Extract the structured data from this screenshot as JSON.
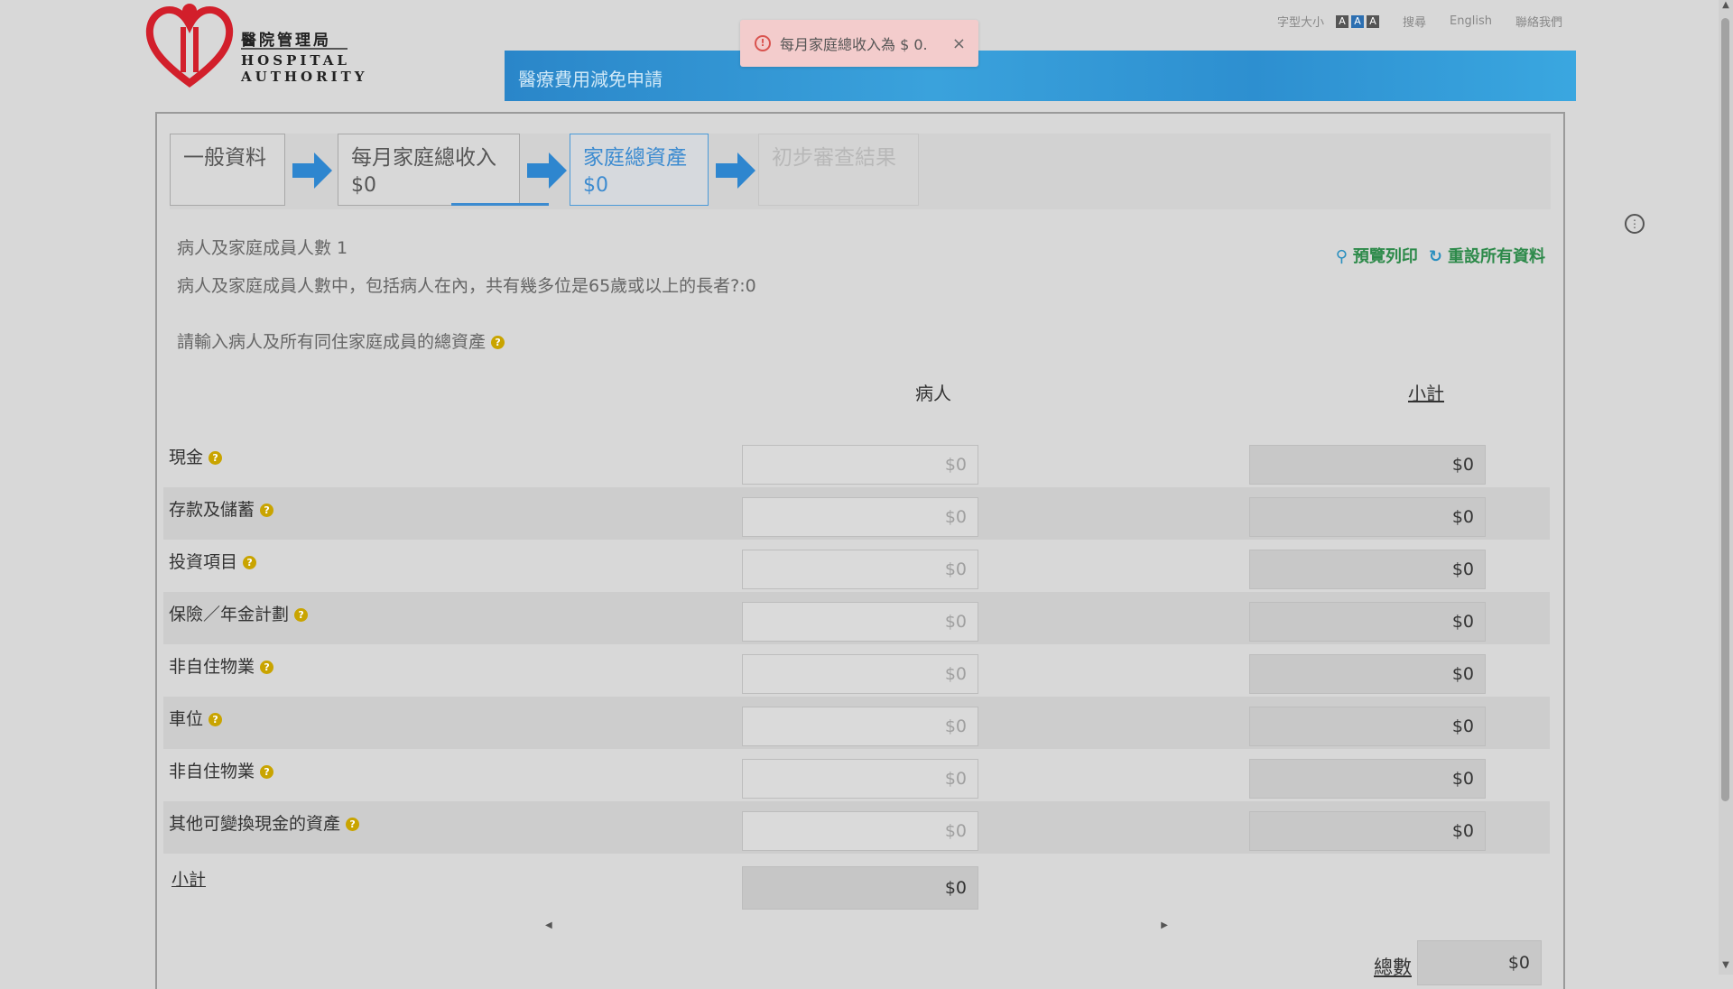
{
  "header": {
    "logo_zh": "醫院管理局",
    "logo_en_1": "HOSPITAL",
    "logo_en_2": "AUTHORITY",
    "font_size_label": "字型大小",
    "font_size_buttons": [
      "A",
      "A",
      "A"
    ],
    "links": [
      "搜尋",
      "English",
      "聯絡我們"
    ],
    "banner_title": "醫療費用減免申請"
  },
  "toast": {
    "message": "每月家庭總收入為 $ 0.",
    "close": "×"
  },
  "steps": [
    {
      "label": "一般資料",
      "amount": ""
    },
    {
      "label": "每月家庭總收入",
      "amount": "$0"
    },
    {
      "label": "家庭總資產",
      "amount": "$0"
    },
    {
      "label": "初步審查結果",
      "amount": ""
    }
  ],
  "info": {
    "members": "病人及家庭成員人數 1",
    "elderly": "病人及家庭成員人數中，包括病人在內，共有幾多位是65歲或以上的長者?:0",
    "instruction": "請輸入病人及所有同住家庭成員的總資產"
  },
  "actions": {
    "preview": "預覽列印",
    "reset": "重設所有資料"
  },
  "columns": {
    "patient": "病人",
    "subtotal": "小計"
  },
  "assets": [
    {
      "label": "現金",
      "patient_placeholder": "$0",
      "subtotal": "$0"
    },
    {
      "label": "存款及儲蓄",
      "patient_placeholder": "$0",
      "subtotal": "$0"
    },
    {
      "label": "投資項目",
      "patient_placeholder": "$0",
      "subtotal": "$0"
    },
    {
      "label": "保險／年金計劃",
      "patient_placeholder": "$0",
      "subtotal": "$0"
    },
    {
      "label": "非自住物業",
      "patient_placeholder": "$0",
      "subtotal": "$0"
    },
    {
      "label": "車位",
      "patient_placeholder": "$0",
      "subtotal": "$0"
    },
    {
      "label": "非自住物業",
      "patient_placeholder": "$0",
      "subtotal": "$0"
    },
    {
      "label": "其他可變換現金的資產",
      "patient_placeholder": "$0",
      "subtotal": "$0"
    }
  ],
  "subtotal_row": {
    "label": "小計",
    "patient_value": "$0"
  },
  "total": {
    "label": "總數",
    "value": "$0"
  },
  "colors": {
    "accent": "#3c8bd0",
    "banner": "#2d8fd0",
    "toast_bg": "#f3cccc",
    "action_green": "#2d8a4a",
    "help_icon": "#c9a400"
  }
}
